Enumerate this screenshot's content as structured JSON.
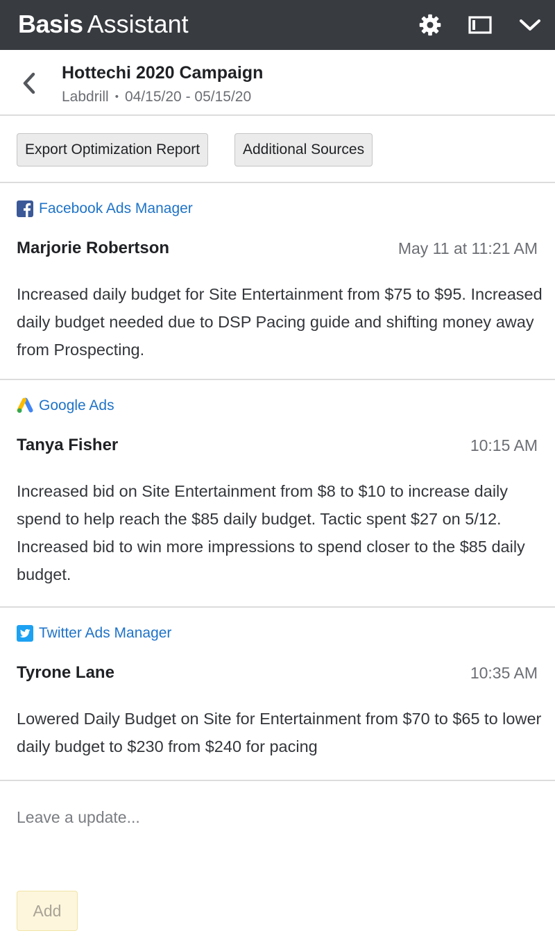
{
  "app": {
    "brand_bold": "Basis",
    "brand_light": "Assistant",
    "icons": {
      "settings": "gear-icon",
      "panel": "panel-toggle-icon",
      "collapse": "chevron-down-icon"
    },
    "colors": {
      "topbar": "#383b40",
      "accent_link": "#1e73c8",
      "add_button_bg": "#fdf6dd"
    }
  },
  "campaign": {
    "title": "Hottechi 2020 Campaign",
    "client": "Labdrill",
    "separator": "•",
    "date_range": "04/15/20 - 05/15/20"
  },
  "actions": {
    "export_label": "Export Optimization Report",
    "sources_label": "Additional Sources"
  },
  "entries": [
    {
      "source": "Facebook Ads Manager",
      "source_icon": "facebook-icon",
      "author": "Marjorie Robertson",
      "time": "May 11 at 11:21 AM",
      "text": "Increased daily budget for Site Entertainment from $75 to $95. Increased daily budget needed due to DSP Pacing guide and shifting money away from Prospecting."
    },
    {
      "source": "Google Ads",
      "source_icon": "google-ads-icon",
      "author": "Tanya Fisher",
      "time": "10:15 AM",
      "text": "Increased bid on Site Entertainment from $8 to $10 to increase daily spend to help reach the $85 daily budget. Tactic spent $27 on 5/12. Increased bid to win more impressions to spend closer to the $85 daily budget."
    },
    {
      "source": "Twitter Ads Manager",
      "source_icon": "twitter-icon",
      "author": "Tyrone Lane",
      "time": "10:35 AM",
      "text": "Lowered Daily Budget on Site for Entertainment from $70 to $65 to lower daily budget to $230 from $240 for pacing"
    }
  ],
  "compose": {
    "placeholder": "Leave a update...",
    "value": "",
    "add_label": "Add"
  }
}
